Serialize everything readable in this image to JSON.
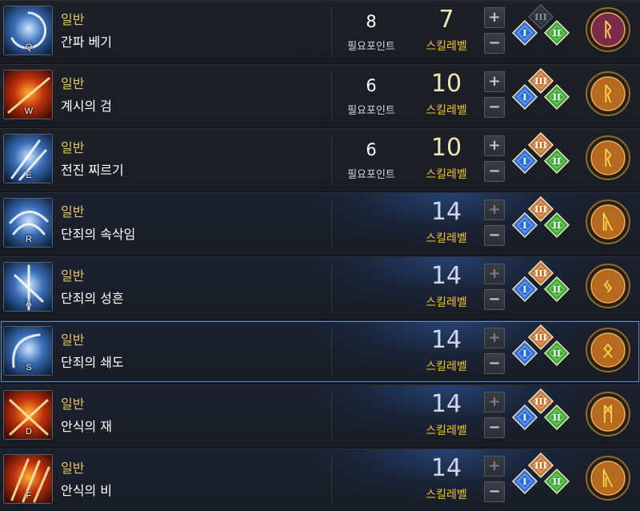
{
  "labels": {
    "required_points": "필요포인트",
    "skill_level": "스킬레벨"
  },
  "skills": [
    {
      "hotkey": "Q",
      "category": "일반",
      "name": "간파 베기",
      "required_points": "8",
      "level": "7",
      "theme": "ice",
      "tripods_active": [
        false,
        true,
        true
      ],
      "rune_color": "#7a2a4a",
      "rune_glyph": "ᚱ"
    },
    {
      "hotkey": "W",
      "category": "일반",
      "name": "계시의 검",
      "required_points": "6",
      "level": "10",
      "theme": "fire",
      "tripods_active": [
        true,
        true,
        true
      ],
      "rune_color": "#b56a20",
      "rune_glyph": "ᚱ"
    },
    {
      "hotkey": "E",
      "category": "일반",
      "name": "전진 찌르기",
      "required_points": "6",
      "level": "10",
      "theme": "ice",
      "tripods_active": [
        true,
        true,
        true
      ],
      "rune_color": "#b56a20",
      "rune_glyph": "ᚱ"
    },
    {
      "hotkey": "R",
      "category": "일반",
      "name": "단죄의 속삭임",
      "required_points": "",
      "level": "14",
      "theme": "ice",
      "tripods_active": [
        true,
        true,
        true
      ],
      "rune_color": "#b56a20",
      "rune_glyph": "ᚣ"
    },
    {
      "hotkey": "A",
      "category": "일반",
      "name": "단죄의 성흔",
      "required_points": "",
      "level": "14",
      "theme": "ice",
      "tripods_active": [
        true,
        true,
        true
      ],
      "rune_color": "#b56a20",
      "rune_glyph": "ᛃ"
    },
    {
      "hotkey": "S",
      "category": "일반",
      "name": "단죄의 쇄도",
      "required_points": "",
      "level": "14",
      "theme": "ice",
      "tripods_active": [
        true,
        true,
        true
      ],
      "rune_color": "#b56a20",
      "rune_glyph": "ᛟ"
    },
    {
      "hotkey": "D",
      "category": "일반",
      "name": "안식의 재",
      "required_points": "",
      "level": "14",
      "theme": "fire",
      "tripods_active": [
        true,
        true,
        true
      ],
      "rune_color": "#b56a20",
      "rune_glyph": "ᛗ"
    },
    {
      "hotkey": "F",
      "category": "일반",
      "name": "안식의 비",
      "required_points": "",
      "level": "14",
      "theme": "fire",
      "tripods_active": [
        true,
        true,
        true
      ],
      "rune_color": "#b56a20",
      "rune_glyph": "ᚣ"
    }
  ],
  "selected_hotkey": "S",
  "colors": {
    "category": "#e3c16a",
    "skill_level_label": "#f2c23a",
    "tripod_1": "#2e6fd8",
    "tripod_2": "#3fa83a",
    "tripod_3": "#c8773a"
  }
}
